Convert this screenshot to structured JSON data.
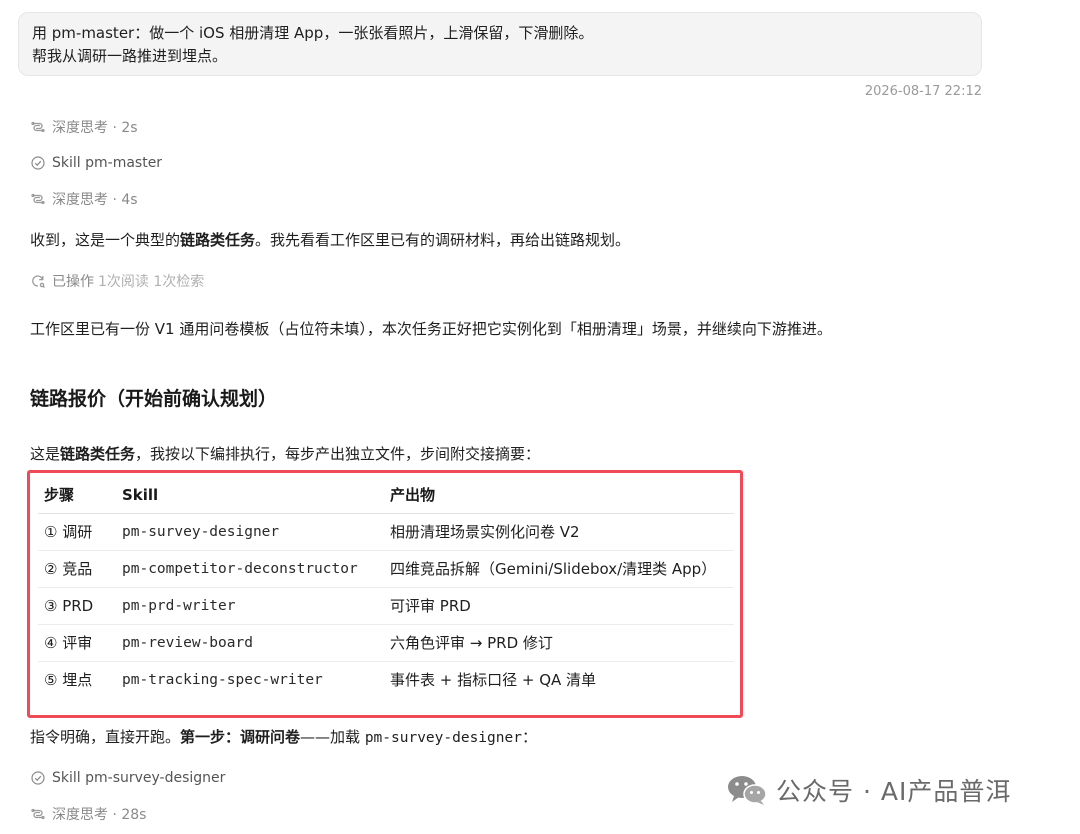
{
  "user_message": {
    "line1": "用 pm-master：做一个 iOS 相册清理 App，一张张看照片，上滑保留，下滑删除。",
    "line2": "帮我从调研一路推进到埋点。",
    "timestamp": "2026-08-17 22:12"
  },
  "steps_meta": [
    {
      "icon": "deep-think-icon",
      "text": "深度思考 · 2s"
    },
    {
      "icon": "check-circle-icon",
      "text": "Skill pm-master"
    },
    {
      "icon": "deep-think-icon",
      "text": "深度思考 · 4s"
    }
  ],
  "reply": {
    "p1_pre": "收到，这是一个典型的",
    "p1_bold": "链路类任务",
    "p1_post": "。我先看看工作区里已有的调研材料，再给出链路规划。",
    "ops_label": "已操作",
    "ops_detail": "1次阅读 1次检索",
    "p2": "工作区里已有一份 V1 通用问卷模板（占位符未填），本次任务正好把它实例化到「相册清理」场景，并继续向下游推进。",
    "heading": "链路报价（开始前确认规划）",
    "p3_pre": "这是",
    "p3_bold": "链路类任务",
    "p3_post": "，我按以下编排执行，每步产出独立文件，步间附交接摘要：",
    "p4_pre": "指令明确，直接开跑。",
    "p4_bold": "第一步：调研问卷",
    "p4_mid": "——加载 ",
    "p4_code": "pm-survey-designer",
    "p4_post": "："
  },
  "table": {
    "headers": [
      "步骤",
      "Skill",
      "产出物"
    ],
    "rows": [
      [
        "① 调研",
        "pm-survey-designer",
        "相册清理场景实例化问卷 V2"
      ],
      [
        "② 竞品",
        "pm-competitor-deconstructor",
        "四维竞品拆解（Gemini/Slidebox/清理类 App）"
      ],
      [
        "③ PRD",
        "pm-prd-writer",
        "可评审 PRD"
      ],
      [
        "④ 评审",
        "pm-review-board",
        "六角色评审 → PRD 修订"
      ],
      [
        "⑤ 埋点",
        "pm-tracking-spec-writer",
        "事件表 + 指标口径 + QA 清单"
      ]
    ]
  },
  "after_meta": [
    {
      "icon": "check-circle-icon",
      "text": "Skill pm-survey-designer"
    },
    {
      "icon": "deep-think-icon",
      "text": "深度思考 · 28s"
    }
  ],
  "watermark": {
    "icon": "wechat-icon",
    "text": "公众号 · AI产品普洱"
  },
  "colors": {
    "highlight_border": "#ef4a55",
    "bubble_bg": "#f4f4f5",
    "muted": "#8a8a8a"
  }
}
